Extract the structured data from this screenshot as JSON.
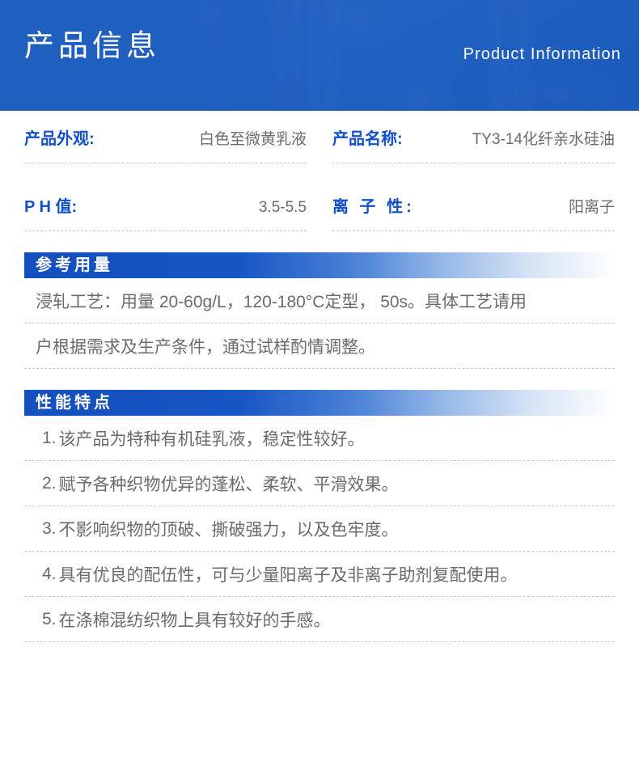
{
  "header": {
    "title": "产品信息",
    "subtitle": "Product Information",
    "accent_color": "#1f5fc0"
  },
  "specs": {
    "label_color": "#1250c8",
    "value_color": "#6b6b6b",
    "left_column": [
      {
        "label": "产品外观:",
        "value": "白色至微黄乳液"
      },
      {
        "label": "P H 值:",
        "value": "3.5-5.5"
      }
    ],
    "right_column": [
      {
        "label": "产品名称:",
        "value": "TY3-14化纤亲水硅油"
      },
      {
        "label": "离 子 性:",
        "value": "阳离子"
      }
    ]
  },
  "dosage_section": {
    "heading": "参考用量",
    "lines": [
      "浸轧工艺：用量 20-60g/L，120-180°C定型， 50s。具体工艺请用",
      "户根据需求及生产条件，通过试样酌情调整。"
    ]
  },
  "features_section": {
    "heading": "性能特点",
    "items": [
      {
        "num": "1.",
        "text": "该产品为特种有机硅乳液，稳定性较好。"
      },
      {
        "num": "2.",
        "text": "赋予各种织物优异的蓬松、柔软、平滑效果。"
      },
      {
        "num": "3.",
        "text": "不影响织物的顶破、撕破强力，以及色牢度。"
      },
      {
        "num": "4.",
        "text": "具有优良的配伍性，可与少量阳离子及非离子助剂复配使用。"
      },
      {
        "num": "5.",
        "text": "在涤棉混纺织物上具有较好的手感。"
      }
    ]
  }
}
